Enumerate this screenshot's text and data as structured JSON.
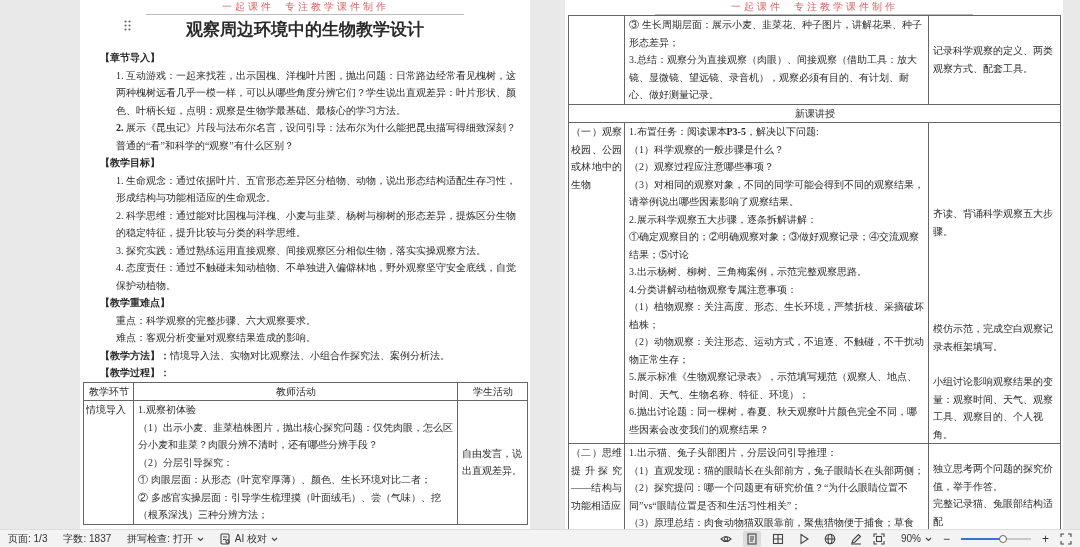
{
  "pages": [
    {
      "header": "一起课件  专注教学课件制作",
      "title": "观察周边环境中的生物教学设计",
      "blocks": [
        {
          "kind": "heading",
          "text": "【章节导入】"
        },
        {
          "kind": "paragraph",
          "text": "1. 互动游戏：一起来找茬，出示国槐、洋槐叶片图，抛出问题：日常路边经常看见槐树，这两种槐树远看几乎一模一样，可以从哪些角度分辨它们？学生说出直观差异：叶片形状、颜色、叶柄长短，点明：观察是生物学最基础、最核心的学习方法。"
        },
        {
          "kind": "paragraph",
          "text": "**2.** 展示《昆虫记》片段与法布尔名言，设问引导：法布尔为什么能把昆虫描写得细致深刻？普通的“看”和科学的“观察”有什么区别？"
        },
        {
          "kind": "heading",
          "text": "【教学目标】"
        },
        {
          "kind": "paragraph",
          "text": "1. 生命观念：通过依据叶片、五官形态差异区分植物、动物，说出形态结构适配生存习性，形成结构与功能相适应的生命观念。"
        },
        {
          "kind": "paragraph",
          "text": "2. 科学思维：通过能对比国槐与洋槐、小麦与韭菜、杨树与柳树的形态差异，提炼区分生物的稳定特征，提升比较与分类的科学思维。"
        },
        {
          "kind": "paragraph",
          "text": "3. 探究实践：通过熟练运用直接观察、间接观察区分相似生物，落实实操观察方法。"
        },
        {
          "kind": "paragraph",
          "text": "4. 态度责任：通过不触碰未知动植物、不单独进入偏僻林地，野外观察坚守安全底线，自觉保护动植物。"
        },
        {
          "kind": "heading",
          "text": "【教学重难点】"
        },
        {
          "kind": "paragraph",
          "text": "重点：科学观察的完整步骤、六大观察要求。"
        },
        {
          "kind": "paragraph",
          "text": "难点：客观分析变量对观察结果造成的影响。"
        },
        {
          "kind": "lead",
          "text": "**【教学方法】：**情境导入法、实物对比观察法、小组合作探究法、案例分析法。"
        },
        {
          "kind": "lead",
          "text": "**【教学过程】：**"
        },
        {
          "kind": "table",
          "columns": [
            "教学环节",
            "教师活动",
            "学生活动"
          ],
          "rows": [
            {
              "kind": "activity",
              "stage": "情境导入",
              "teacher": [
                "1.观察初体验",
                "（1）出示小麦、韭菜植株图片，抛出核心探究问题：仅凭肉眼，怎么区分小麦和韭菜？肉眼分辨不清时，还有哪些分辨手段？",
                "（2）分层引导探究：",
                "① 肉眼层面：从形态（叶宽窄厚薄）、颜色、生长环境对比二者；",
                "② 多感官实操层面：引导学生梳理摸（叶面绒毛）、尝（气味）、挖（根系深浅）三种分辨方法；"
              ],
              "student": [
                "自由发言，说出直观差异。"
              ]
            }
          ]
        }
      ]
    },
    {
      "header": "一起课件  专注教学课件制作",
      "blocks": [
        {
          "kind": "table",
          "rows": [
            {
              "kind": "activity",
              "teacher": [
                "③ 生长周期层面：展示小麦、韭菜花、种子图片，讲解花果、种子形态差异；",
                "3.总结：观察分为直接观察（肉眼）、间接观察（借助工具：放大镜、显微镜、望远镜、录音机），观察必须有目的、有计划、耐心、做好测量记录。"
              ],
              "student": [
                "记录科学观察的定义、两类观察方式、配套工具。"
              ]
            },
            {
              "kind": "section",
              "text": "新课讲授"
            },
            {
              "kind": "activity",
              "stage": "（一）观察校园、公园或林地中的生物",
              "teacher": [
                "1.布置任务：阅读课本**P3-5**，解决以下问题:",
                "（1）科学观察的一般步骤是什么？",
                "（2）观察过程应注意哪些事项？",
                "（3）对相同的观察对象，不同的同学可能会得到不同的观察结果，请举例说出哪些因素影响了观察结果。",
                "2.展示科学观察五大步骤，逐条拆解讲解：",
                "①确定观察目的；②明确观察对象；③做好观察记录；④交流观察结果；⑤讨论",
                "3.出示杨树、柳树、三角梅案例，示范完整观察思路。",
                "4.分类讲解动植物观察专属注意事项：",
                "（1）植物观察：关注高度、形态、生长环境，严禁折枝、采摘破坏植株；",
                "（2）动物观察：关注形态、运动方式，不追逐、不触碰，不干扰动物正常生存；",
                "5.展示标准《生物观察记录表》，示范填写规范（观察人、地点、时间、天气、生物名称、特征、环境）；",
                "6.抛出讨论题：同一棵树，春夏、秋天观察叶片颜色完全不同，哪些因素会改变我们的观察结果？"
              ],
              "student": [
                "齐读、背诵科学观察五大步骤。",
                "模仿示范，完成空白观察记录表框架填写。",
                "小组讨论影响观察结果的变量：观察时间、天气、观察工具、观察目的、个人视角。"
              ]
            },
            {
              "kind": "activity",
              "stage": "（二）思维提升探究——结构与功能相适应",
              "teacher": [
                "1.出示猫、兔子头部图片，分层设问引导推理：",
                "（1）直观发现：猫的眼睛长在头部前方，兔子眼睛长在头部两侧；",
                "（2）探究提问：哪一个问题更有研究价值？“为什么眼睛位置不同”vs“眼睛位置是否和生活习性相关”；",
                "（3）原理总结：肉食动物猫双眼靠前，聚焦猎物便于捕食；草食"
              ],
              "student": [
                "独立思考两个问题的探究价值，举手作答。",
                "完整记录猫、兔眼部结构适配"
              ]
            }
          ]
        }
      ]
    }
  ],
  "status_bar": {
    "page": "页面: 1/3",
    "words": "字数: 1837",
    "spell_check": "拼写检查: 打开",
    "ai_check": "AI 校对",
    "view_buttons": [
      {
        "selected": false
      },
      {
        "selected": true
      },
      {
        "selected": false
      },
      {
        "selected": false
      },
      {
        "selected": false
      },
      {
        "selected": false
      }
    ],
    "zoom": {
      "value": "90%",
      "zoom_out": "−",
      "zoom_in": "+",
      "level": 0.6
    }
  }
}
